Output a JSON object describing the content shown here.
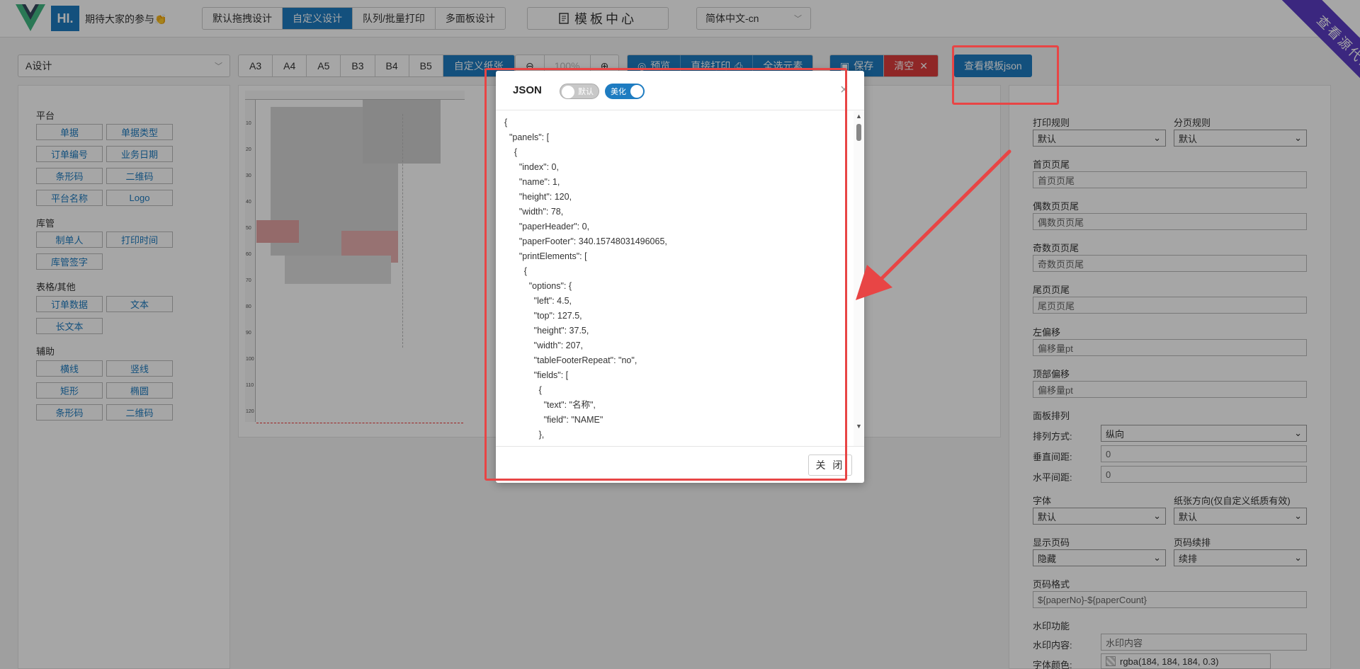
{
  "header": {
    "logo_text": "HI.",
    "slogan": "期待大家的参与👏",
    "modes": [
      "默认拖拽设计",
      "自定义设计",
      "队列/批量打印",
      "多面板设计"
    ],
    "template_center": "模板中心",
    "template_center_icon": "template-icon",
    "language": "简体中文-cn",
    "ribbon": "查看源代码"
  },
  "toolbar": {
    "template_select": "A设计",
    "paper_sizes": [
      "A3",
      "A4",
      "A5",
      "B3",
      "B4",
      "B5",
      "自定义纸张"
    ],
    "zoom_value": "100%",
    "actions": [
      "预览",
      "直接打印",
      "全选元素"
    ],
    "save_label": "保存",
    "clear_label": "清空",
    "view_json_label": "查看模板json"
  },
  "left_panel": {
    "groups": [
      {
        "title": "平台",
        "items": [
          "单据",
          "单据类型",
          "订单编号",
          "业务日期",
          "条形码",
          "二维码",
          "平台名称",
          "Logo"
        ]
      },
      {
        "title": "库管",
        "items": [
          "制单人",
          "打印时间",
          "库管签字"
        ]
      },
      {
        "title": "表格/其他",
        "items": [
          "订单数据",
          "文本",
          "长文本"
        ]
      },
      {
        "title": "辅助",
        "items": [
          "横线",
          "竖线",
          "矩形",
          "椭圆",
          "条形码",
          "二维码"
        ]
      }
    ]
  },
  "ruler": {
    "vertical_ticks": [
      "10",
      "20",
      "30",
      "40",
      "50",
      "60",
      "70",
      "80",
      "90",
      "100",
      "110",
      "120"
    ]
  },
  "right_panel": {
    "print_rule_label": "打印规则",
    "print_rule_value": "默认",
    "page_rule_label": "分页规则",
    "page_rule_value": "默认",
    "first_header_label": "首页页尾",
    "first_header_placeholder": "首页页尾",
    "even_footer_label": "偶数页页尾",
    "even_footer_placeholder": "偶数页页尾",
    "odd_footer_label": "奇数页页尾",
    "odd_footer_placeholder": "奇数页页尾",
    "tail_footer_label": "尾页页尾",
    "tail_footer_placeholder": "尾页页尾",
    "left_offset_label": "左偏移",
    "left_offset_placeholder": "偏移量pt",
    "top_offset_label": "顶部偏移",
    "top_offset_placeholder": "偏移量pt",
    "panel_layout_label": "面板排列",
    "layout_dir_label": "排列方式:",
    "layout_dir_value": "纵向",
    "v_gap_label": "垂直间距:",
    "v_gap_value": "0",
    "h_gap_label": "水平间距:",
    "h_gap_value": "0",
    "font_label": "字体",
    "font_value": "默认",
    "paper_dir_label": "纸张方向(仅自定义纸质有效)",
    "paper_dir_value": "默认",
    "show_page_label": "显示页码",
    "show_page_value": "隐藏",
    "page_continue_label": "页码续排",
    "page_continue_value": "续排",
    "page_format_label": "页码格式",
    "page_format_value": "${paperNo}-${paperCount}",
    "watermark_label": "水印功能",
    "watermark_content_label": "水印内容:",
    "watermark_content_placeholder": "水印内容",
    "font_color_label": "字体颜色:",
    "font_color_value": "rgba(184, 184, 184, 0.3)"
  },
  "modal": {
    "title": "JSON",
    "toggle_default": "默认",
    "toggle_beautify": "美化",
    "close_icon": "×",
    "json_text": "{\n  \"panels\": [\n    {\n      \"index\": 0,\n      \"name\": 1,\n      \"height\": 120,\n      \"width\": 78,\n      \"paperHeader\": 0,\n      \"paperFooter\": 340.15748031496065,\n      \"printElements\": [\n        {\n          \"options\": {\n            \"left\": 4.5,\n            \"top\": 127.5,\n            \"height\": 37.5,\n            \"width\": 207,\n            \"tableFooterRepeat\": \"no\",\n            \"fields\": [\n              {\n                \"text\": \"名称\",\n                \"field\": \"NAME\"\n              },",
    "close_button": "关 闭"
  },
  "colors": {
    "primary": "#1e7cc1",
    "danger": "#dc3d3d",
    "annotation": "#e84545",
    "ribbon": "#5b3cc4"
  }
}
